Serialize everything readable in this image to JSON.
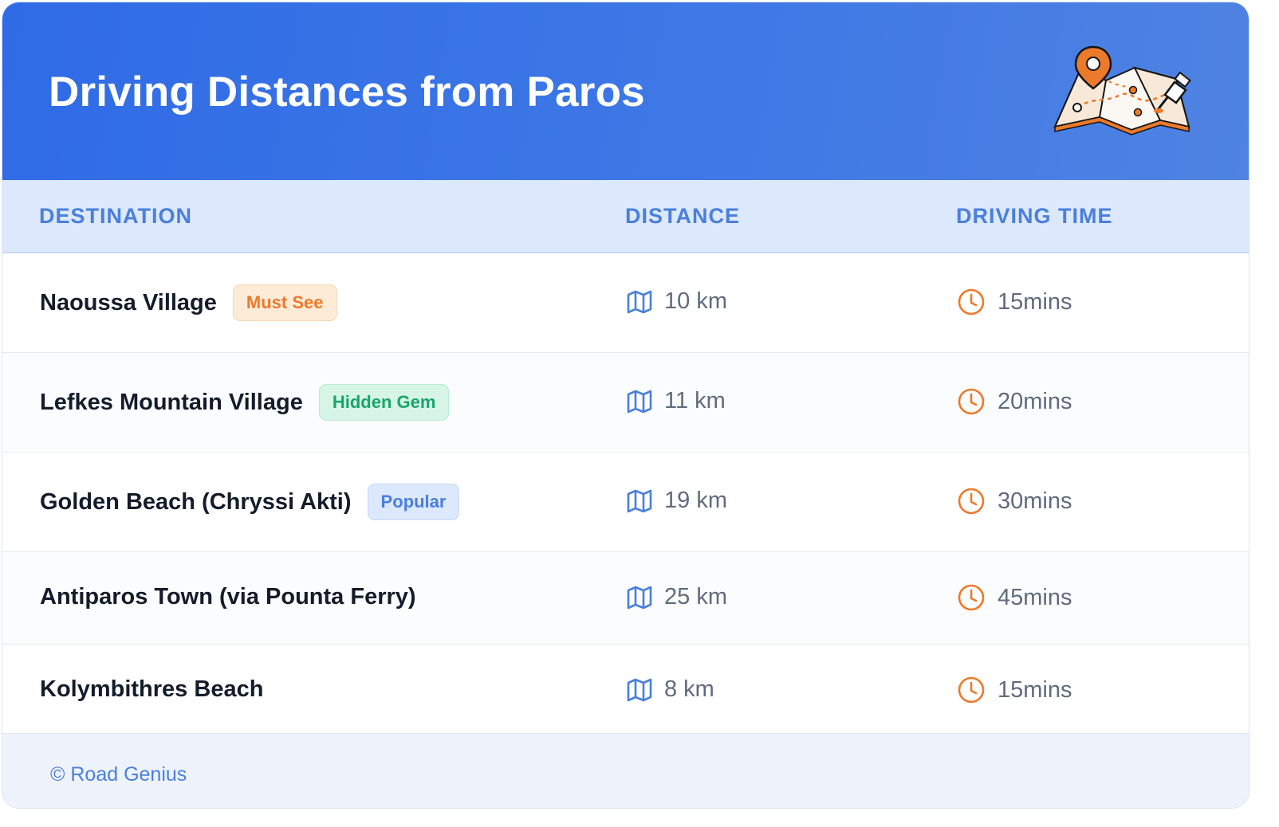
{
  "header": {
    "title": "Driving Distances from Paros"
  },
  "columns": [
    "DESTINATION",
    "DISTANCE",
    "DRIVING TIME"
  ],
  "rows": [
    {
      "destination": "Naoussa Village",
      "badge": "Must See",
      "badge_color": "#ec7a2b",
      "distance": "10 km",
      "time": "15mins"
    },
    {
      "destination": "Lefkes Mountain Village",
      "badge": "Hidden Gem",
      "badge_color": "#19a56a",
      "distance": "11 km",
      "time": "20mins"
    },
    {
      "destination": "Golden Beach (Chryssi Akti)",
      "badge": "Popular",
      "badge_color": "#4a7fdc",
      "distance": "19 km",
      "time": "30mins"
    },
    {
      "destination": "Antiparos Town (via Pounta Ferry)",
      "badge": null,
      "distance": "25 km",
      "time": "45mins"
    },
    {
      "destination": "Kolymbithres Beach",
      "badge": null,
      "distance": "8 km",
      "time": "15mins"
    }
  ],
  "icons": {
    "distance": "map-icon",
    "time": "clock-icon",
    "header": "map-pin-illustration"
  },
  "footer": {
    "credit": "© Road Genius"
  },
  "colors": {
    "header_start": "#2f6be6",
    "header_end": "#4f82e2",
    "accent_blue": "#4a7fdc",
    "accent_orange": "#ec7a2b"
  }
}
